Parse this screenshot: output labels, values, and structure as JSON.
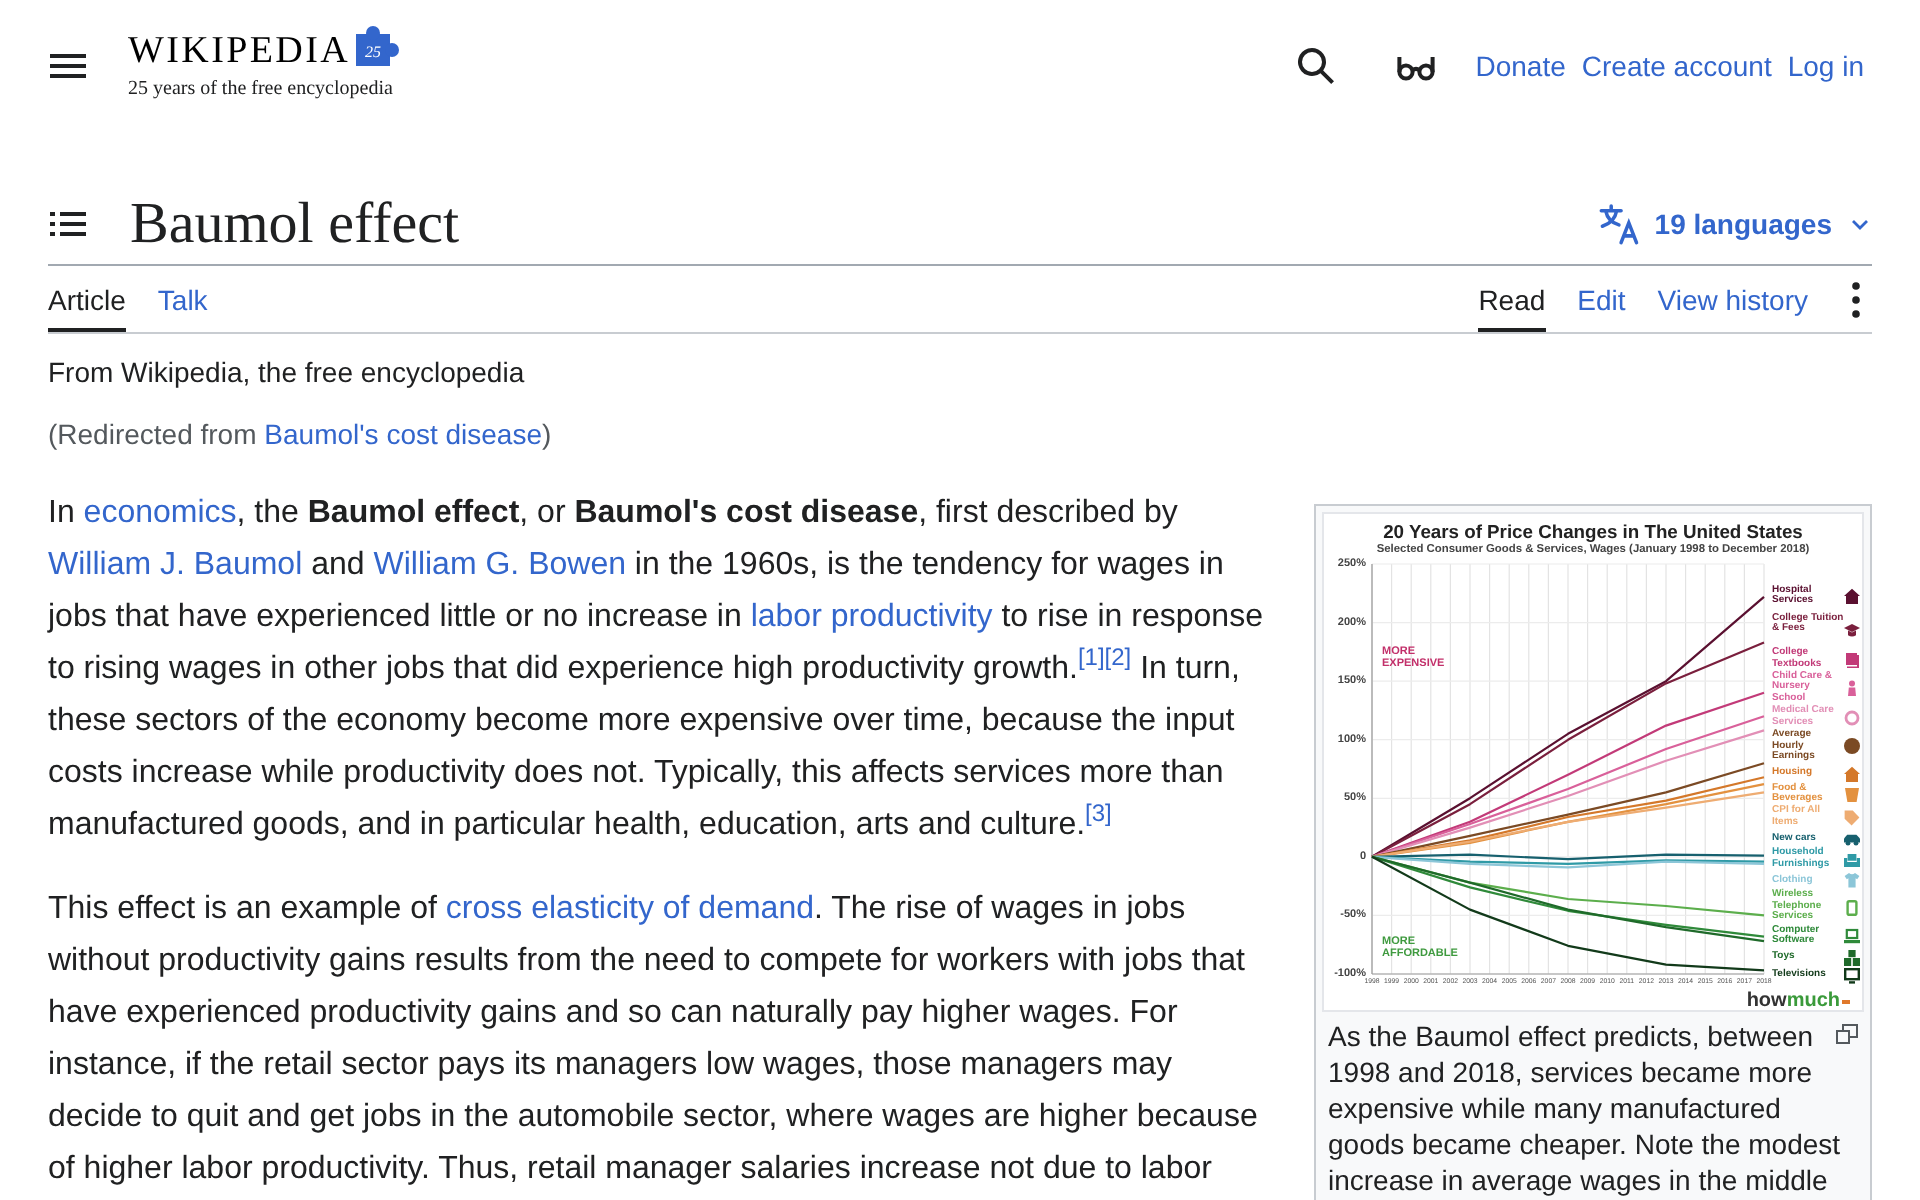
{
  "header": {
    "logo": {
      "wordmark": "WIKIPEDIA",
      "badge": "25",
      "tagline": "25 years of the free encyclopedia"
    },
    "links": [
      "Donate",
      "Create account",
      "Log in"
    ]
  },
  "title_bar": {
    "title": "Baumol effect",
    "languages": "19 languages"
  },
  "tabs_left": [
    {
      "label": "Article",
      "selected": true
    },
    {
      "label": "Talk",
      "selected": false
    }
  ],
  "tabs_right": [
    {
      "label": "Read",
      "selected": true
    },
    {
      "label": "Edit",
      "selected": false
    },
    {
      "label": "View history",
      "selected": false
    }
  ],
  "site_tagline": "From Wikipedia, the free encyclopedia",
  "redirect": [
    {
      "kind": "text",
      "text": "(Redirected from "
    },
    {
      "kind": "link",
      "text": "Baumol's cost disease"
    },
    {
      "kind": "text",
      "text": ")"
    }
  ],
  "paragraphs": [
    [
      {
        "kind": "text",
        "text": "In "
      },
      {
        "kind": "link",
        "text": "economics"
      },
      {
        "kind": "text",
        "text": ", the **Baumol effect**, or **Baumol's cost disease**, first described by "
      },
      {
        "kind": "link",
        "text": "William J. Baumol"
      },
      {
        "kind": "text",
        "text": " and "
      },
      {
        "kind": "link",
        "text": "William G. Bowen"
      },
      {
        "kind": "text",
        "text": " in the 1960s, is the tendency for wages in jobs that have experienced little or no increase in "
      },
      {
        "kind": "link",
        "text": "labor productivity"
      },
      {
        "kind": "text",
        "text": " to rise in response to rising wages in other jobs that did experience high productivity growth."
      },
      {
        "kind": "ref",
        "text": "[1]"
      },
      {
        "kind": "ref",
        "text": "[2]"
      },
      {
        "kind": "text",
        "text": " In turn, these sectors of the economy become more expensive over time, because the input costs increase while productivity does not. Typically, this affects services more than manufactured goods, and in particular health, education, arts and culture."
      },
      {
        "kind": "ref",
        "text": "[3]"
      }
    ],
    [
      {
        "kind": "text",
        "text": "This effect is an example of "
      },
      {
        "kind": "link",
        "text": "cross elasticity of demand"
      },
      {
        "kind": "text",
        "text": ". The rise of wages in jobs without productivity gains results from the need to compete for workers with jobs that have experienced productivity gains and so can naturally pay higher wages. For instance, if the retail sector pays its managers low wages, those managers may decide to quit and get jobs in the automobile sector, where wages are higher because of higher labor productivity. Thus, retail manager salaries increase not due to labor"
      }
    ]
  ],
  "figure": {
    "chart_data": {
      "type": "line",
      "title": "20 Years of Price Changes in The United States",
      "x": [
        1998,
        2003,
        2008,
        2013,
        2018
      ],
      "xlim": [
        1998,
        2018
      ],
      "ylim": [
        -100,
        250
      ],
      "xticks": [
        1998,
        1999,
        2000,
        2001,
        2002,
        2003,
        2004,
        2005,
        2006,
        2007,
        2008,
        2009,
        2010,
        2011,
        2012,
        2013,
        2014,
        2015,
        2016,
        2017,
        2018
      ],
      "yticks": [
        {
          "value": 250,
          "label": "250%"
        },
        {
          "value": 200,
          "label": "200%"
        },
        {
          "value": 150,
          "label": "150%"
        },
        {
          "value": 100,
          "label": "100%"
        },
        {
          "value": 50,
          "label": "50%"
        },
        {
          "value": 0,
          "label": "0"
        },
        {
          "value": -50,
          "label": "-50%"
        },
        {
          "value": -100,
          "label": "-100%"
        }
      ],
      "grid": true,
      "legend": "right",
      "series": [
        {
          "name": "Hospital Services",
          "color": "#5a1030",
          "values": [
            0,
            50,
            105,
            150,
            222
          ]
        },
        {
          "name": "College Tuition & Fees",
          "color": "#7a1f3d",
          "values": [
            0,
            45,
            100,
            148,
            183
          ]
        },
        {
          "name": "College Textbooks",
          "color": "#c23a78",
          "values": [
            0,
            30,
            70,
            112,
            140
          ]
        },
        {
          "name": "Child Care & Nursery School",
          "color": "#d9609a",
          "values": [
            0,
            28,
            58,
            92,
            120
          ]
        },
        {
          "name": "Medical Care Services",
          "color": "#e28fb6",
          "values": [
            0,
            25,
            52,
            82,
            108
          ]
        },
        {
          "name": "Average Hourly Earnings",
          "color": "#7b4a24",
          "values": [
            0,
            18,
            36,
            55,
            80
          ]
        },
        {
          "name": "Housing",
          "color": "#d4782a",
          "values": [
            0,
            14,
            34,
            48,
            68
          ]
        },
        {
          "name": "Food & Beverages",
          "color": "#e3913f",
          "values": [
            0,
            12,
            30,
            45,
            62
          ]
        },
        {
          "name": "CPI for All Items",
          "color": "#eeac72",
          "values": [
            0,
            13,
            30,
            42,
            55
          ]
        },
        {
          "name": "New cars",
          "color": "#17606e",
          "values": [
            0,
            2,
            -2,
            2,
            1
          ]
        },
        {
          "name": "Household Furnishings",
          "color": "#2f9aa6",
          "values": [
            0,
            -4,
            -6,
            -3,
            -4
          ]
        },
        {
          "name": "Clothing",
          "color": "#8cc6d8",
          "values": [
            0,
            -6,
            -9,
            -4,
            -6
          ]
        },
        {
          "name": "Wireless Telephone Services",
          "color": "#5cae4c",
          "values": [
            0,
            -22,
            -36,
            -42,
            -50
          ]
        },
        {
          "name": "Computer Software",
          "color": "#2f8a3a",
          "values": [
            0,
            -26,
            -46,
            -58,
            -68
          ]
        },
        {
          "name": "Toys",
          "color": "#1f6a2a",
          "values": [
            0,
            -22,
            -45,
            -60,
            -72
          ]
        },
        {
          "name": "Televisions",
          "color": "#123a1a",
          "values": [
            0,
            -45,
            -76,
            -92,
            -97
          ]
        }
      ],
      "annotations": [
        "MORE EXPENSIVE",
        "MORE AFFORDABLE"
      ]
    },
    "chart_subtitle": "Selected Consumer Goods & Services, Wages (January 1998 to December 2018)",
    "chart_logo": [
      "how",
      "much"
    ],
    "caption": "As the Baumol effect predicts, between 1998 and 2018, services became more expensive while many manufactured goods became cheaper. Note the modest increase in average wages in the middle"
  }
}
